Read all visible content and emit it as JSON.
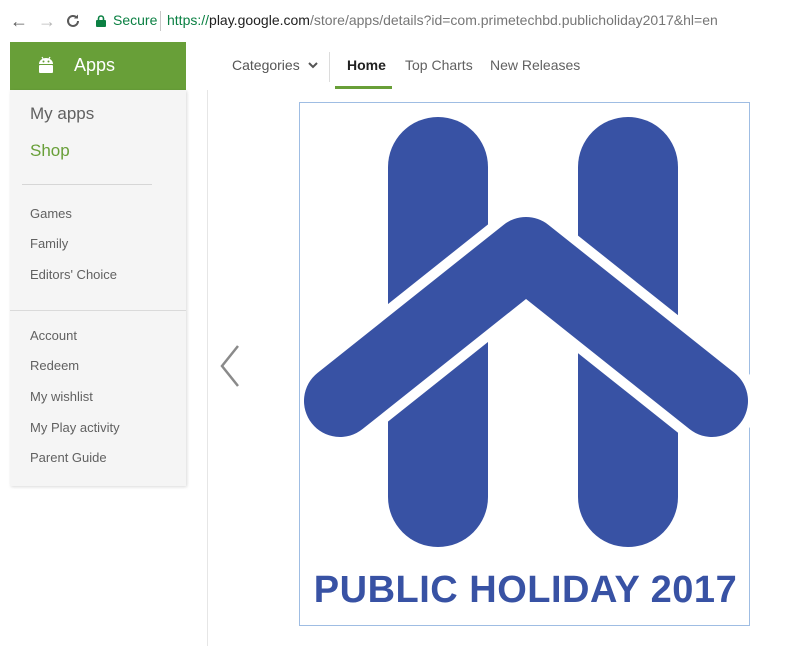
{
  "browser": {
    "back_icon": "arrow-left-icon",
    "forward_icon": "arrow-right-icon",
    "reload_icon": "reload-icon",
    "secure_label": "Secure",
    "url_scheme": "https://",
    "url_host": "play.google.com",
    "url_path": "/store/apps/details?id=com.primetechbd.publicholiday2017&hl=en"
  },
  "header": {
    "apps_label": "Apps",
    "apps_icon": "android-icon",
    "accent_color": "#689f38"
  },
  "topnav": {
    "categories_label": "Categories",
    "tabs": [
      {
        "label": "Home",
        "active": true
      },
      {
        "label": "Top Charts",
        "active": false
      },
      {
        "label": "New Releases",
        "active": false
      }
    ]
  },
  "sidebar": {
    "main": [
      {
        "label": "My apps",
        "active": false
      },
      {
        "label": "Shop",
        "active": true
      }
    ],
    "categories": [
      {
        "label": "Games"
      },
      {
        "label": "Family"
      },
      {
        "label": "Editors' Choice"
      }
    ],
    "account": [
      {
        "label": "Account"
      },
      {
        "label": "Redeem"
      },
      {
        "label": "My wishlist"
      },
      {
        "label": "My Play activity"
      },
      {
        "label": "Parent Guide"
      }
    ]
  },
  "banner": {
    "caption": "PUBLIC HOLIDAY 2017",
    "logo_color": "#3852a4",
    "prev_icon": "chevron-left-icon"
  }
}
